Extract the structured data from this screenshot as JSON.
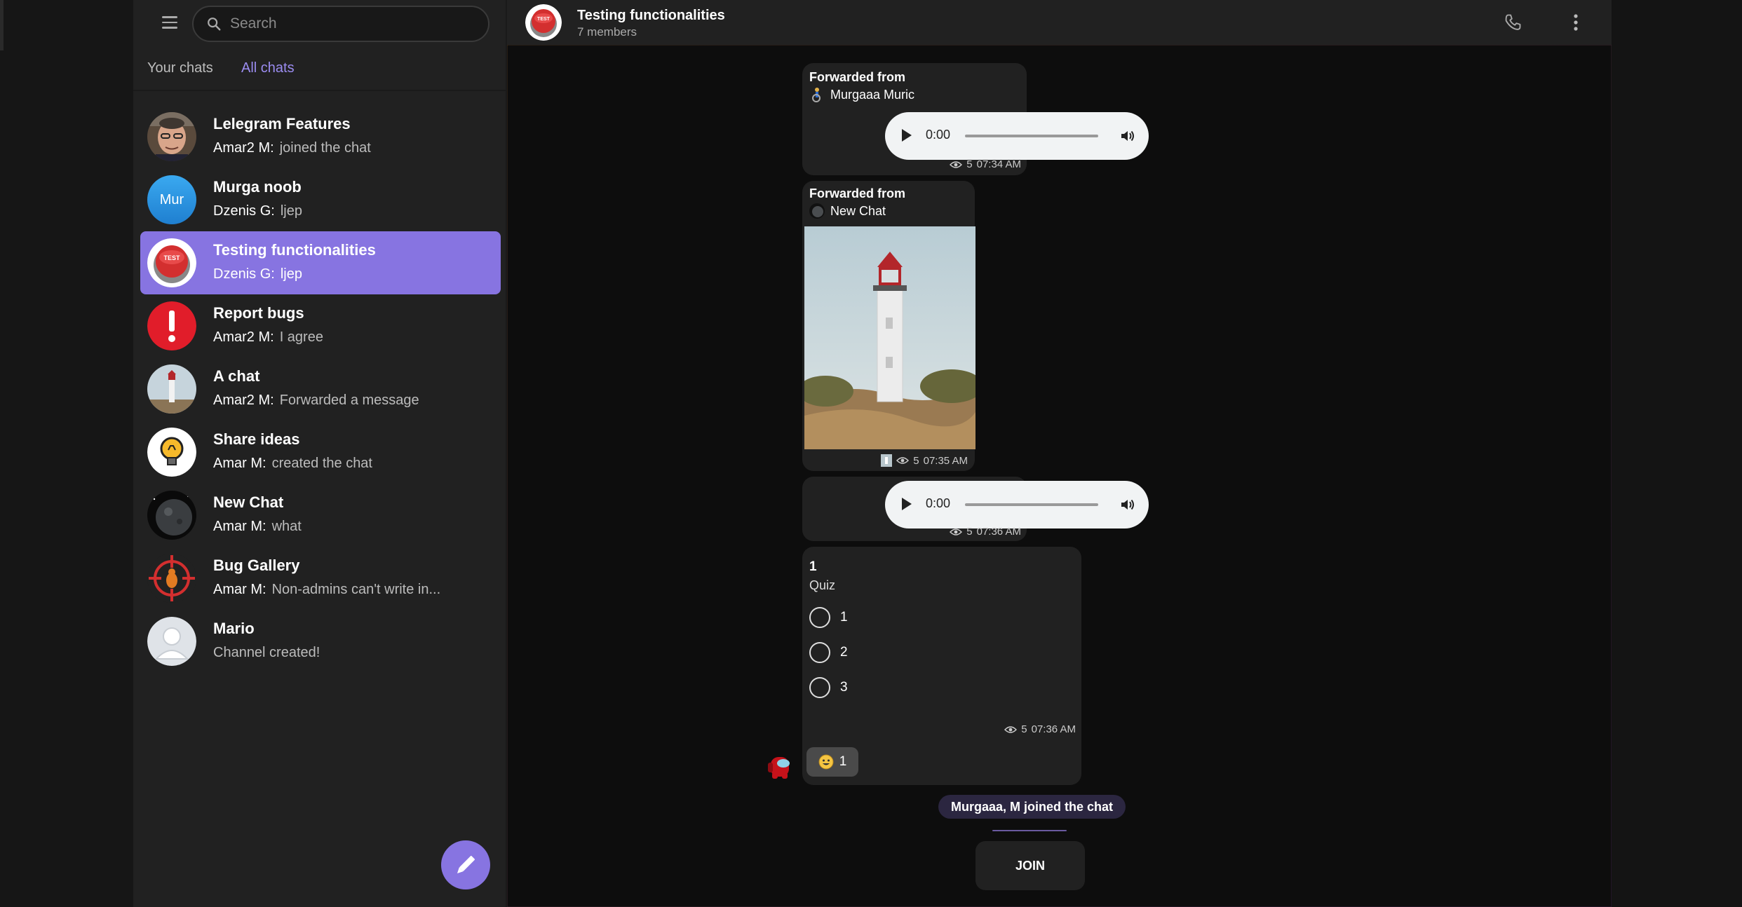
{
  "sidebar": {
    "search_placeholder": "Search",
    "tabs": [
      {
        "label": "Your chats",
        "active": false
      },
      {
        "label": "All chats",
        "active": true
      }
    ],
    "chats": [
      {
        "title": "Lelegram Features",
        "sender": "Amar2 M:",
        "preview": "joined the chat",
        "avatar": "photo-person"
      },
      {
        "title": "Murga noob",
        "sender": "Dzenis G:",
        "preview": "ljep",
        "avatar_text": "Mur",
        "avatar_color": "#2b9be0"
      },
      {
        "title": "Testing functionalities",
        "sender": "Dzenis G:",
        "preview": "ljep",
        "avatar": "red-test-button",
        "active": true
      },
      {
        "title": "Report bugs",
        "sender": "Amar2 M:",
        "preview": "I agree",
        "avatar": "exclamation",
        "avatar_color": "#e53935"
      },
      {
        "title": "A chat",
        "sender": "Amar2 M:",
        "preview": "Forwarded a message",
        "avatar": "lighthouse"
      },
      {
        "title": "Share ideas",
        "sender": "Amar M:",
        "preview": "created the chat",
        "avatar": "lightbulb"
      },
      {
        "title": "New Chat",
        "sender": "Amar M:",
        "preview": "what",
        "avatar": "planet"
      },
      {
        "title": "Bug Gallery",
        "sender": "Amar M:",
        "preview": "Non-admins can't write in...",
        "avatar": "bug-target"
      },
      {
        "title": "Mario",
        "sender": "",
        "preview": "Channel created!",
        "avatar": "default-user"
      }
    ]
  },
  "header": {
    "title": "Testing functionalities",
    "subtitle": "7 members",
    "avatar_text": "TEST"
  },
  "messages": {
    "msg1": {
      "forwarded_label": "Forwarded from",
      "from": "Murgaaa Muric",
      "audio_time": "0:00",
      "views": "5",
      "time": "07:34 AM"
    },
    "msg2": {
      "forwarded_label": "Forwarded from",
      "from": "New Chat",
      "views": "5",
      "time": "07:35 AM"
    },
    "msg3": {
      "audio_time": "0:00",
      "views": "5",
      "time": "07:36 AM"
    },
    "poll": {
      "question": "1",
      "type": "Quiz",
      "options": [
        "1",
        "2",
        "3"
      ],
      "views": "5",
      "time": "07:36 AM",
      "reaction_count": "1"
    },
    "service": "Murgaaa, M joined the chat"
  },
  "join_label": "JOIN",
  "colors": {
    "accent": "#8774e1",
    "panel": "#212121",
    "pattern_warm": "#6b4a2a",
    "pattern_cool": "#5a2a6b"
  }
}
